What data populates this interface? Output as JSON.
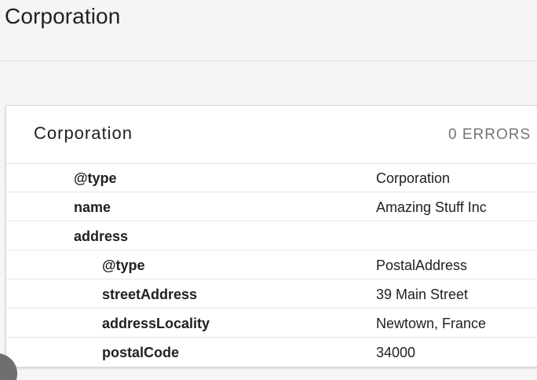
{
  "header": {
    "title": "Corporation"
  },
  "card": {
    "title": "Corporation",
    "errors": "0 ERRORS",
    "rows": [
      {
        "property": "@type",
        "value": "Corporation",
        "level": 0
      },
      {
        "property": "name",
        "value": "Amazing Stuff Inc",
        "level": 0
      },
      {
        "property": "address",
        "value": "",
        "level": 0
      },
      {
        "property": "@type",
        "value": "PostalAddress",
        "level": 1
      },
      {
        "property": "streetAddress",
        "value": "39 Main Street",
        "level": 1
      },
      {
        "property": "addressLocality",
        "value": "Newtown, France",
        "level": 1
      },
      {
        "property": "postalCode",
        "value": "34000",
        "level": 1
      }
    ]
  }
}
